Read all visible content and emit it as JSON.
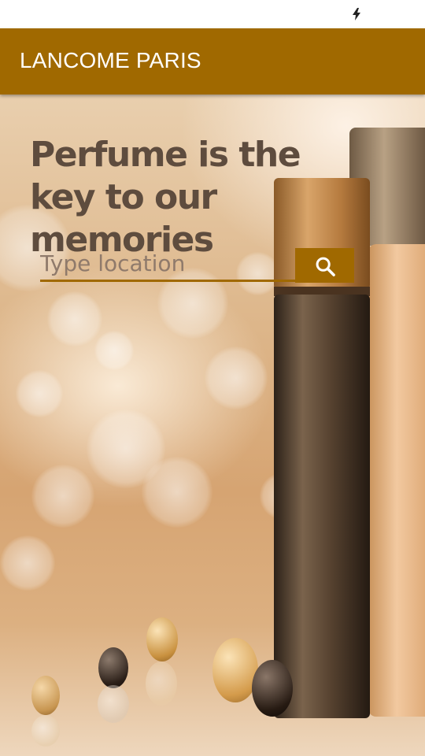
{
  "status_bar": {
    "icons": [
      "flash-icon"
    ]
  },
  "app_bar": {
    "title": "LANCOME PARIS",
    "color": "#a06900"
  },
  "hero": {
    "headline": "Perfume is the key to our memories",
    "background_image": "perfume-bottles-and-pearls"
  },
  "search": {
    "placeholder": "Type location",
    "value": "",
    "button_icon": "search-icon"
  }
}
